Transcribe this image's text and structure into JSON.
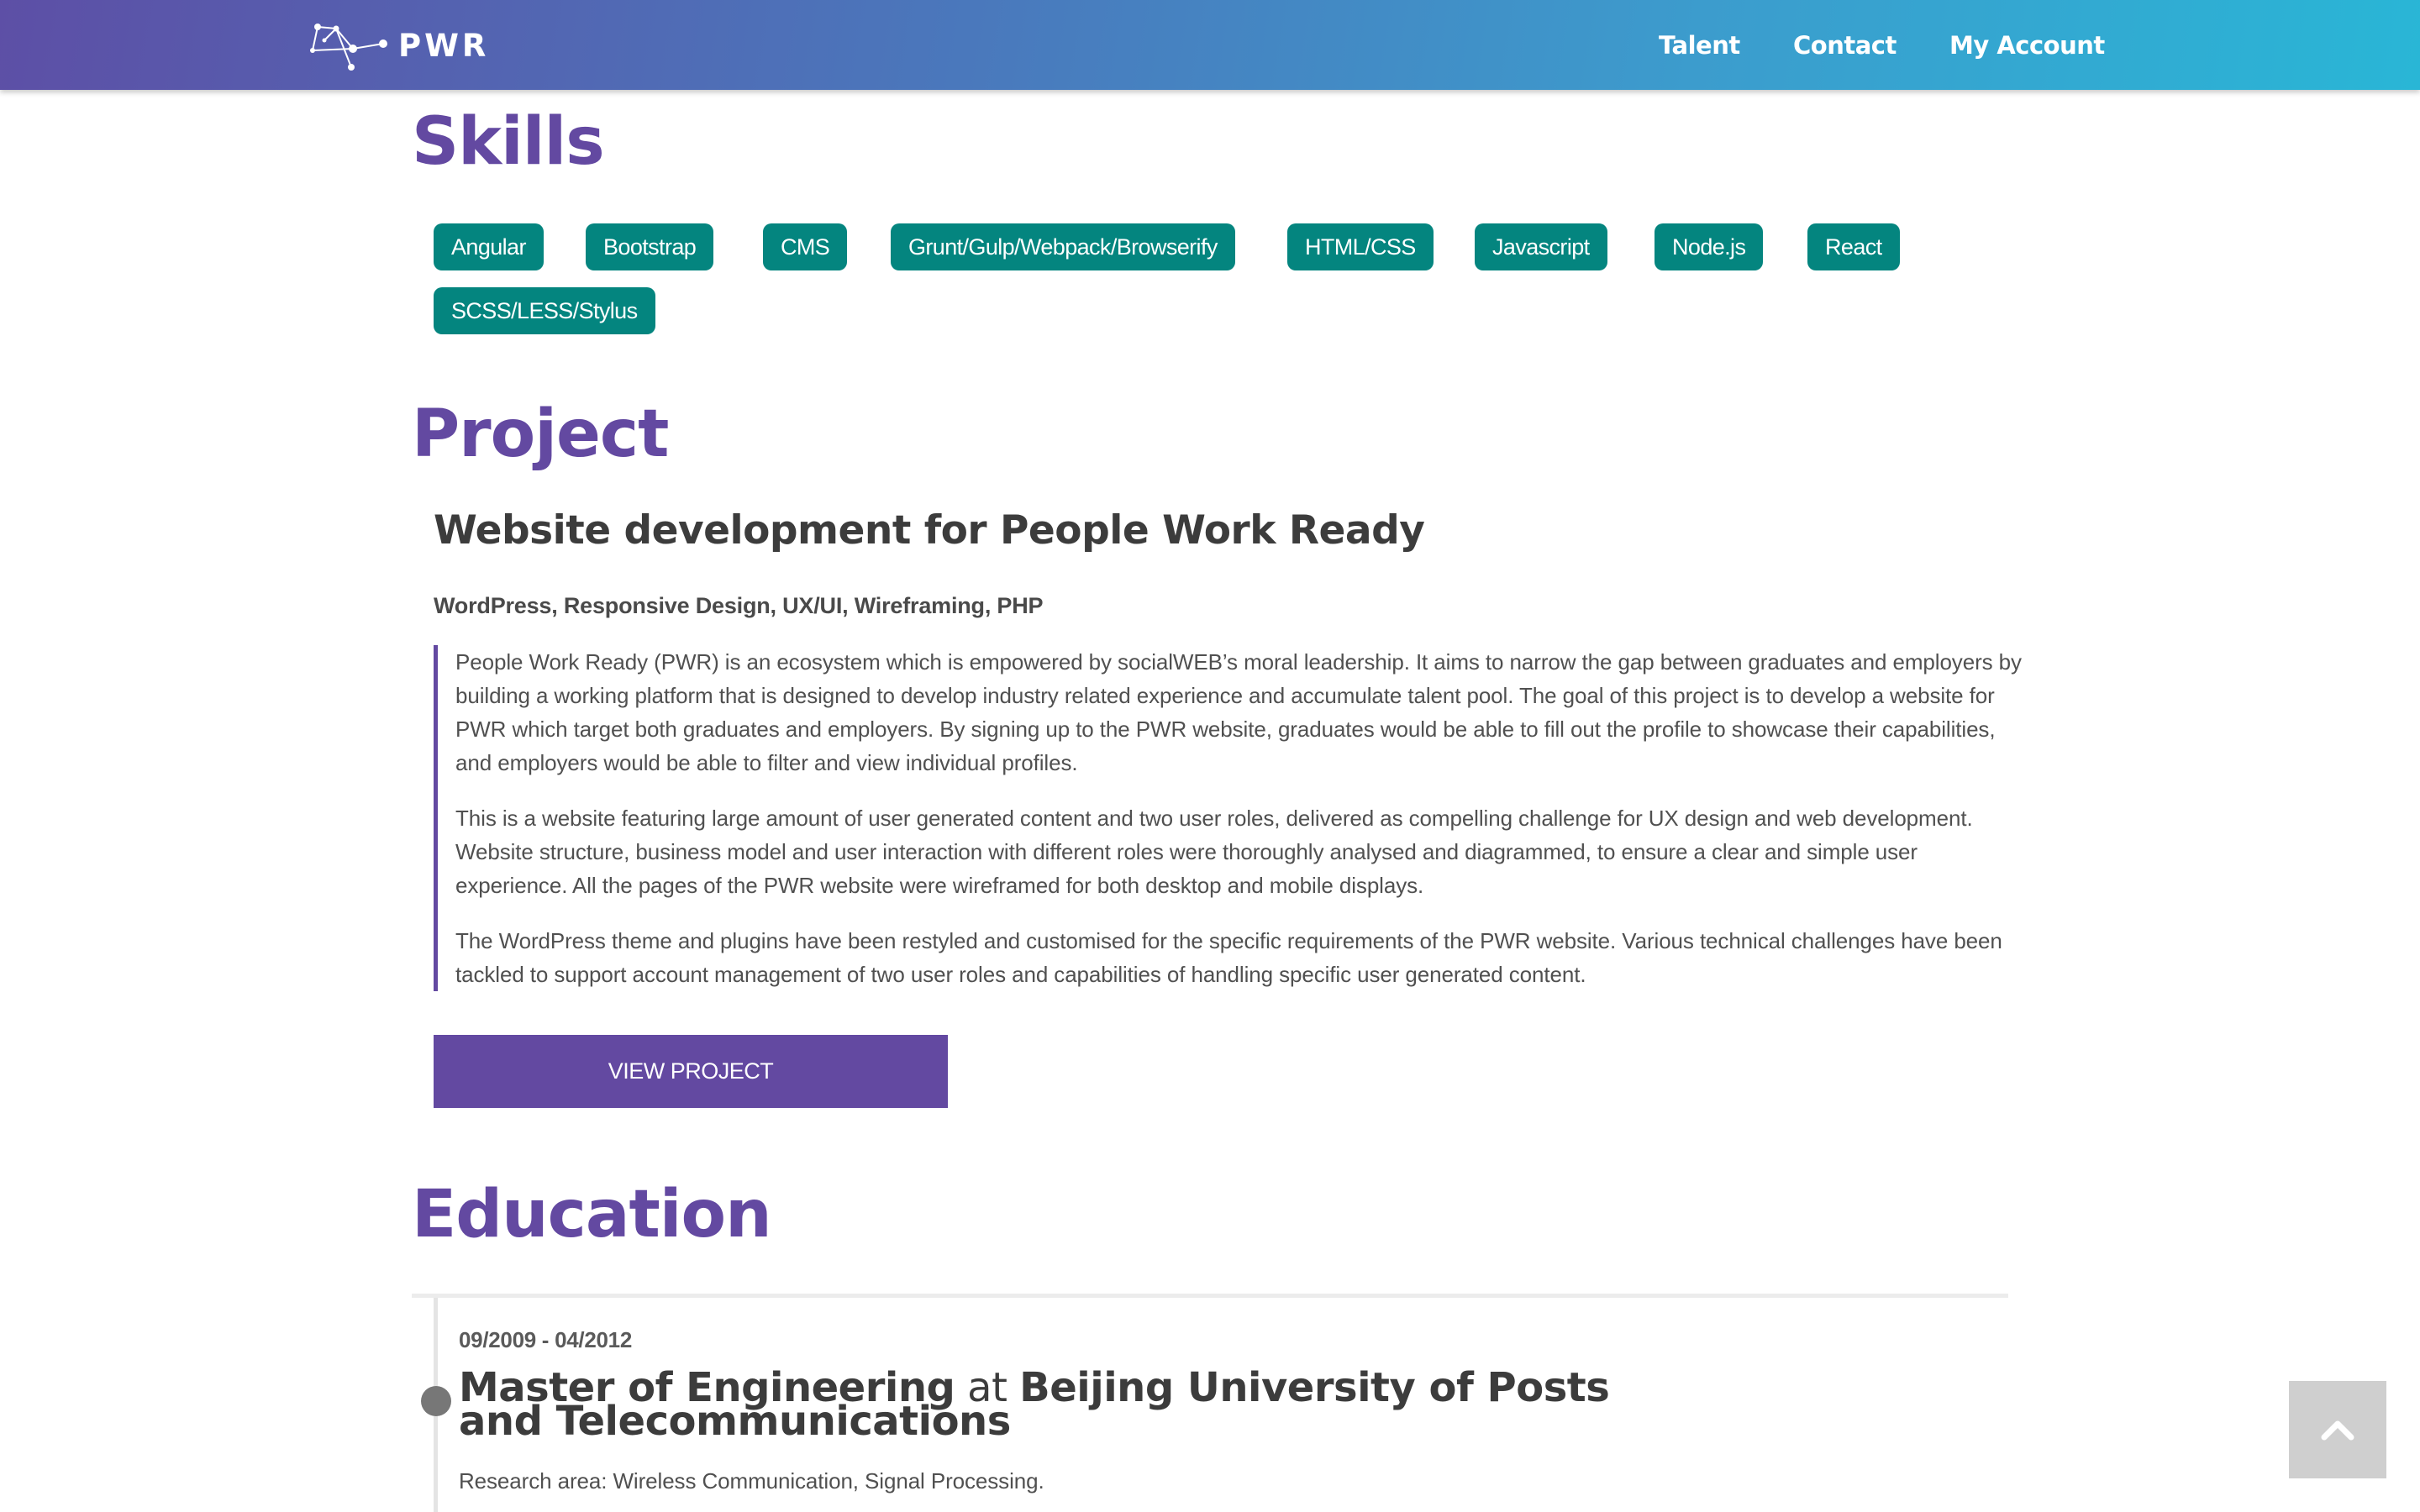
{
  "header": {
    "logo_text": "PWR",
    "nav": {
      "talent": "Talent",
      "contact": "Contact",
      "my_account": "My Account"
    }
  },
  "skills": {
    "title": "Skills",
    "tags": [
      "Angular",
      "Bootstrap",
      "CMS",
      "Grunt/Gulp/Webpack/Browserify",
      "HTML/CSS",
      "Javascript",
      "Node.js",
      "React",
      "SCSS/LESS/Stylus"
    ]
  },
  "project": {
    "title": "Project",
    "name": "Website development for People Work Ready",
    "tech": "WordPress, Responsive Design, UX/UI, Wireframing, PHP",
    "paragraphs": [
      "People Work Ready (PWR) is an ecosystem which is empowered by socialWEB’s moral leadership. It aims to narrow the gap between graduates and employers by building a working platform that is designed to develop industry related experience and accumulate talent pool. The goal of this project is to develop a website for PWR which target both graduates and employers. By signing up to the PWR website, graduates would be able to fill out the profile to showcase their capabilities, and employers would be able to filter and view individual profiles.",
      "This is a website featuring large amount of user generated content and two user roles, delivered as compelling challenge for UX design and web development. Website structure, business model and user interaction with different roles were thoroughly analysed and diagrammed, to ensure a clear and simple user experience. All the pages of the PWR website were wireframed for both desktop and mobile displays.",
      "The WordPress theme and plugins have been restyled and customised for the specific requirements of the PWR website. Various technical challenges have been tackled to support account management of two user roles and capabilities of handling specific user generated content."
    ],
    "button_label": "VIEW PROJECT"
  },
  "education": {
    "title": "Education",
    "entries": [
      {
        "date": "09/2009 - 04/2012",
        "degree": "Master of Engineering",
        "at": "at",
        "school": "Beijing University of Posts and Telecommunications",
        "description": "Research area: Wireless Communication, Signal Processing."
      }
    ]
  },
  "colors": {
    "accent_purple": "#6349a1",
    "tag_teal": "#04857f",
    "header_gradient_start": "#5d4fa6",
    "header_gradient_end": "#29b6d6"
  },
  "icons": {
    "logo": "network-constellation-icon",
    "back_to_top": "chevron-up-icon"
  }
}
